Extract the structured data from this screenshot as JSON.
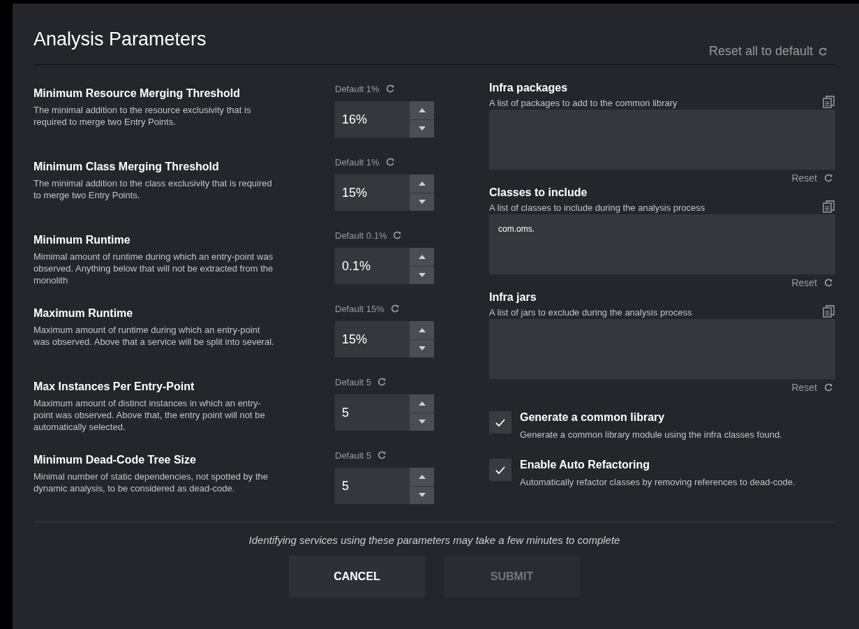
{
  "title": "Analysis Parameters",
  "reset_all": "Reset all to default",
  "parameters": [
    {
      "title": "Minimum Resource Merging Threshold",
      "description": "The minimal addition to the resource exclusivity that is required to merge two Entry Points.",
      "default_label": "Default 1%",
      "value": "16%"
    },
    {
      "title": "Minimum Class Merging Threshold",
      "description": "The minimal addition to the class exclusivity that is required to merge two Entry Points.",
      "default_label": "Default 1%",
      "value": "15%"
    },
    {
      "title": "Minimum Runtime",
      "description": "Mimimal amount of runtime during which an entry-point was observed. Anything below that will not be extracted from the monolith",
      "default_label": "Default 0.1%",
      "value": "0.1%"
    },
    {
      "title": "Maximum Runtime",
      "description": "Maximum amount of runtime during which an entry-point was observed. Above that a service will be split into several.",
      "default_label": "Default 15%",
      "value": "15%"
    },
    {
      "title": "Max Instances Per Entry-Point",
      "description": "Maximum amount of distinct instances in which an entry-point was observed. Above that, the entry point will not be automatically selected.",
      "default_label": "Default 5",
      "value": "5"
    },
    {
      "title": "Minimum Dead-Code Tree Size",
      "description": "Minimal number of static dependencies, not spotted by the dynamic analysis, to be considered as dead-code.",
      "default_label": "Default 5",
      "value": "5"
    }
  ],
  "lists": [
    {
      "title": "Infra packages",
      "description": "A list of packages to add to the common library",
      "reset_label": "Reset"
    },
    {
      "title": "Classes to include",
      "description": "A list of classes to include during the analysis process",
      "value": "com.oms.",
      "reset_label": "Reset"
    },
    {
      "title": "Infra jars",
      "description": "A list of jars to exclude during the analysis process",
      "reset_label": "Reset"
    }
  ],
  "options": [
    {
      "label": "Generate a common library",
      "description": "Generate a common library module using the infra classes found.",
      "checked": true
    },
    {
      "label": "Enable Auto Refactoring",
      "description": "Automatically refactor classes by removing references to dead-code.",
      "checked": true
    }
  ],
  "note": "Identifying services using these parameters may take a few minutes to complete",
  "buttons": [
    {
      "label": "CANCEL",
      "disabled": false
    },
    {
      "label": "SUBMIT",
      "disabled": true
    }
  ]
}
